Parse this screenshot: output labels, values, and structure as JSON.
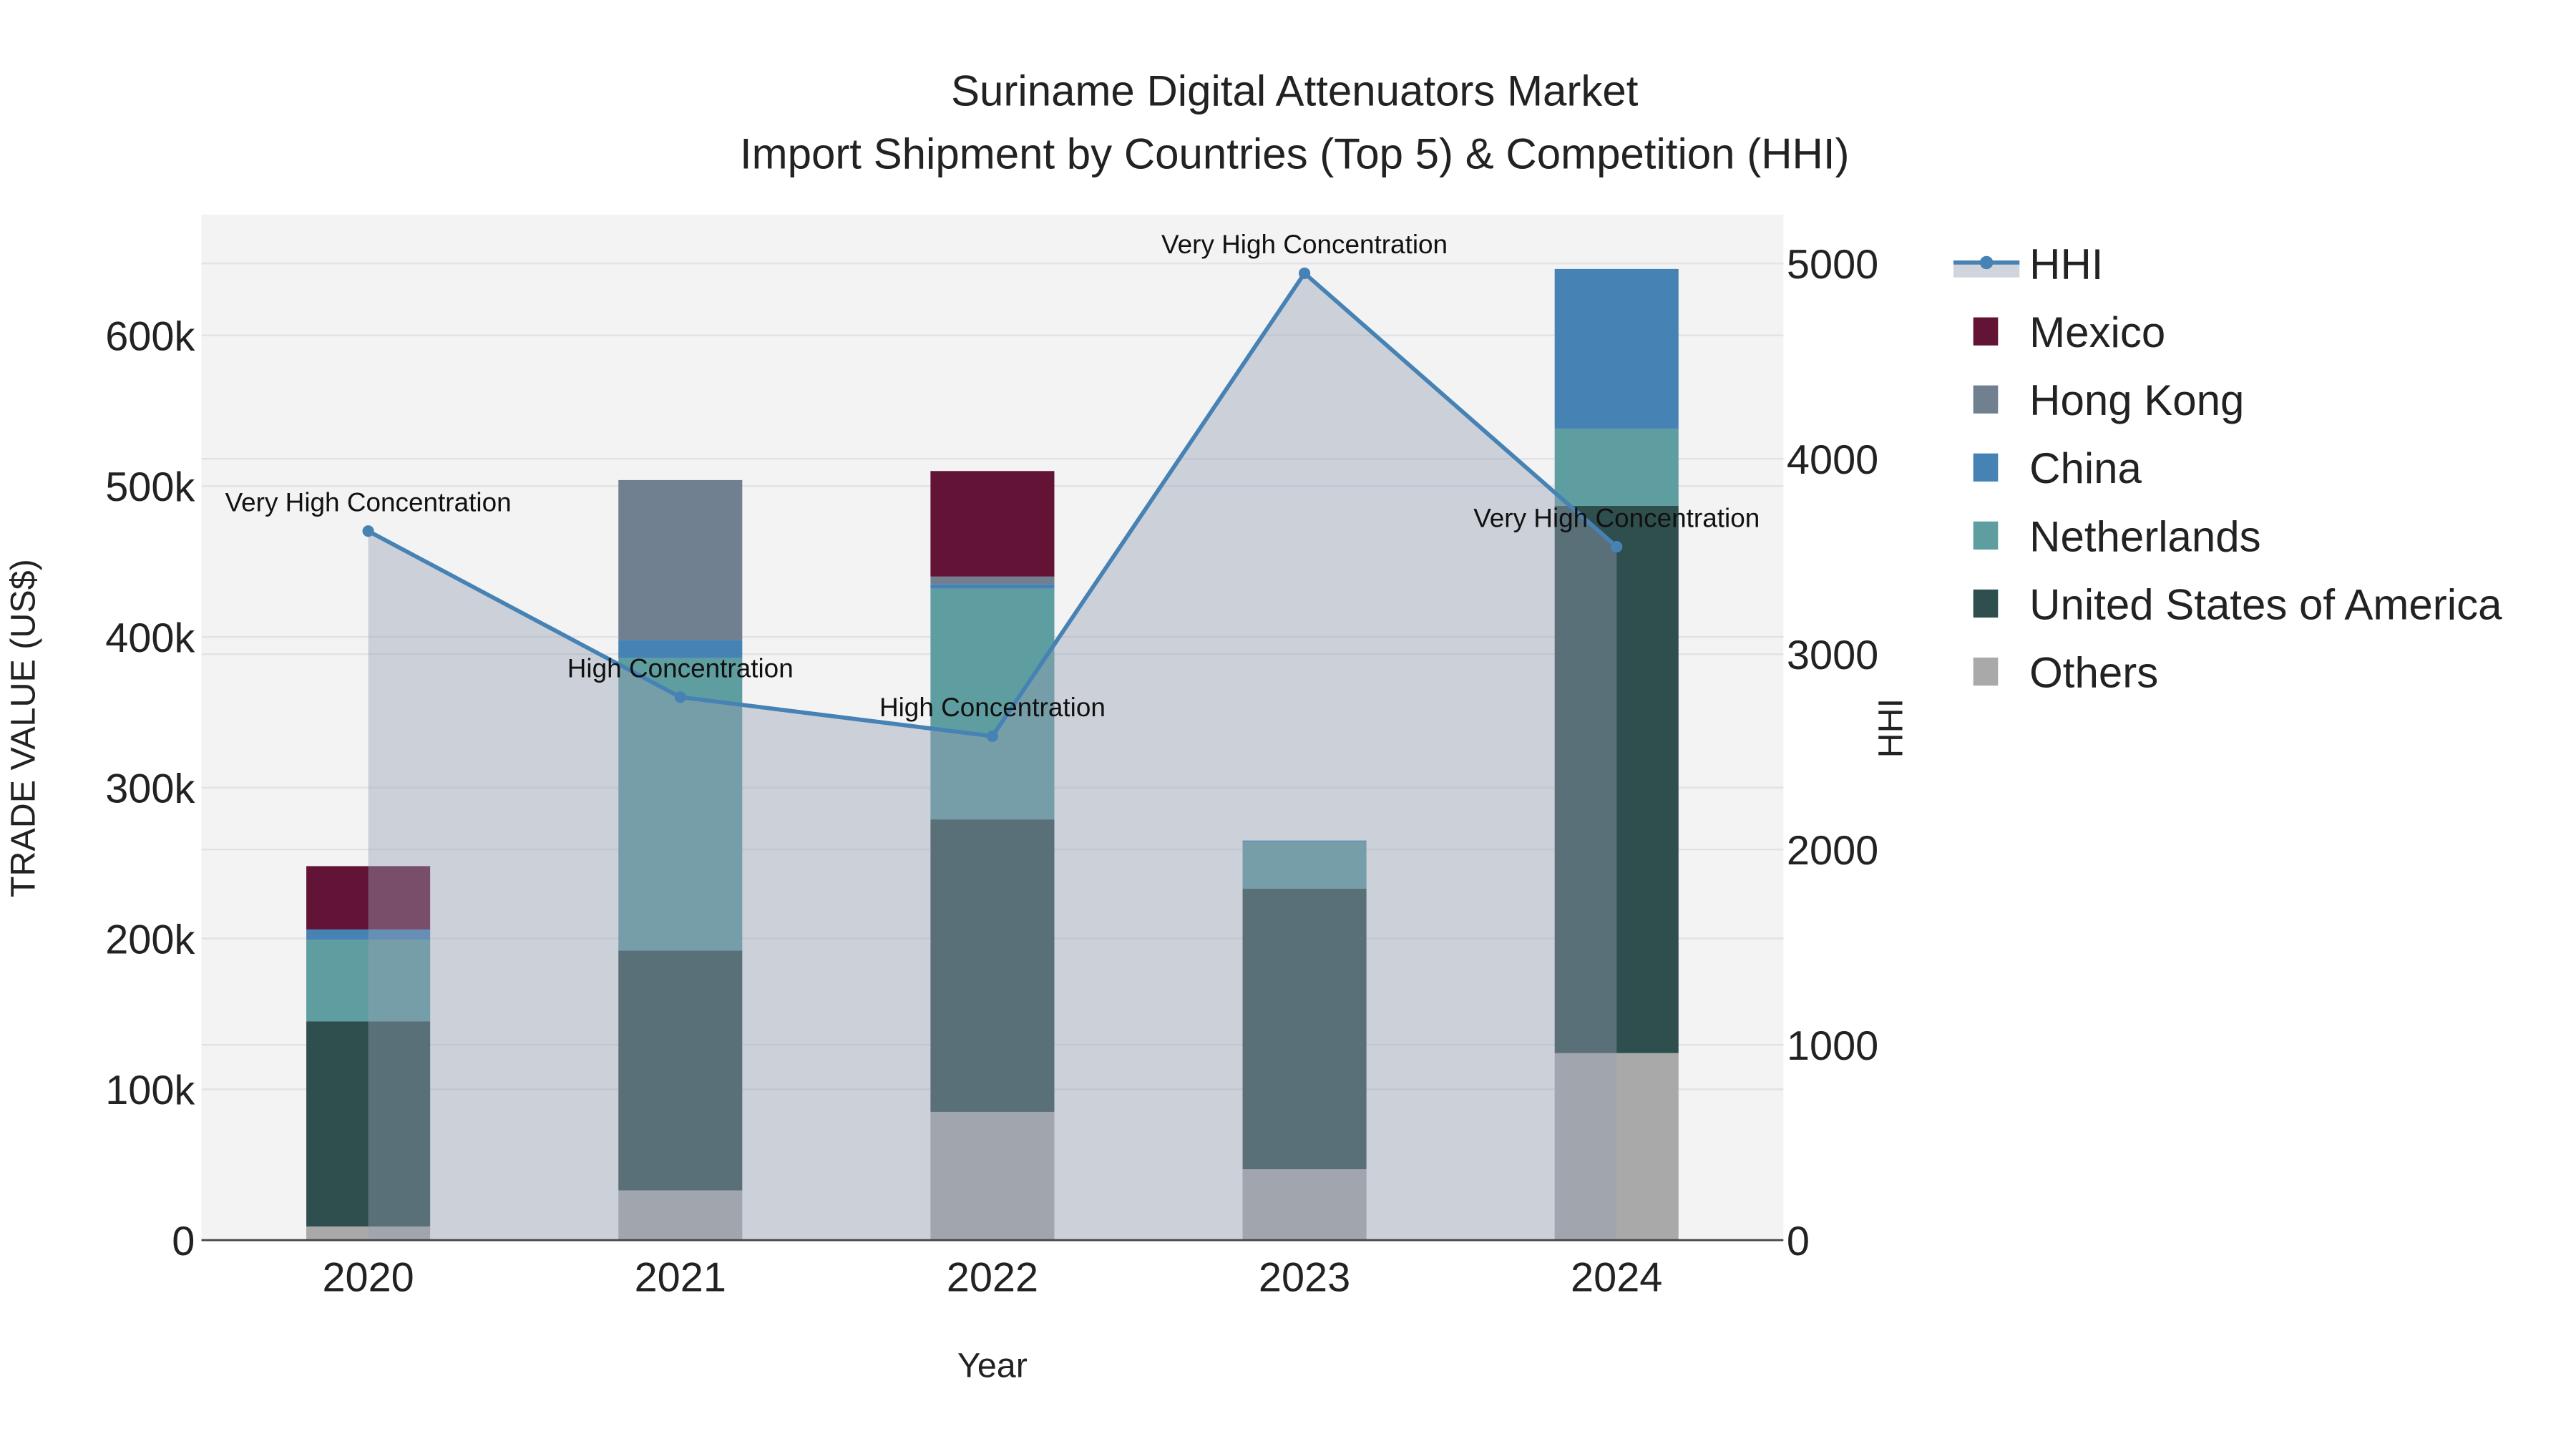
{
  "chart_data": {
    "type": "bar",
    "title_line1": "Suriname Digital Attenuators Market",
    "title_line2": "Import Shipment by Countries (Top 5) & Competition (HHI)",
    "xlabel": "Year",
    "ylabel": "TRADE VALUE (US$)",
    "y2label": "HHI",
    "categories": [
      "2020",
      "2021",
      "2022",
      "2023",
      "2024"
    ],
    "ylim": [
      0,
      680000
    ],
    "y_ticks": [
      0,
      100000,
      200000,
      300000,
      400000,
      500000,
      600000
    ],
    "y_tick_labels": [
      "0",
      "100k",
      "200k",
      "300k",
      "400k",
      "500k",
      "600k"
    ],
    "y2lim": [
      0,
      5250
    ],
    "y2_ticks": [
      0,
      1000,
      2000,
      3000,
      4000,
      5000
    ],
    "y2_tick_labels": [
      "0",
      "1000",
      "2000",
      "3000",
      "4000",
      "5000"
    ],
    "stacked": true,
    "series": [
      {
        "name": "Others",
        "color": "#a9a9a9",
        "values": [
          9000,
          33000,
          85000,
          47000,
          124000
        ]
      },
      {
        "name": "United States of America",
        "color": "#2f4f4f",
        "values": [
          136000,
          159000,
          194000,
          186000,
          363000
        ]
      },
      {
        "name": "Netherlands",
        "color": "#5f9ea0",
        "values": [
          54000,
          194000,
          153000,
          31000,
          51000
        ]
      },
      {
        "name": "China",
        "color": "#4682b4",
        "values": [
          7000,
          12000,
          3000,
          1000,
          106000
        ]
      },
      {
        "name": "Hong Kong",
        "color": "#708090",
        "values": [
          0,
          106000,
          5000,
          0,
          0
        ]
      },
      {
        "name": "Mexico",
        "color": "#621336",
        "values": [
          42000,
          0,
          70000,
          0,
          0
        ]
      }
    ],
    "legend_order": [
      "HHI",
      "Mexico",
      "Hong Kong",
      "China",
      "Netherlands",
      "United States of America",
      "Others"
    ],
    "hhi": {
      "name": "HHI",
      "color": "#4682b4",
      "values": [
        3630,
        2780,
        2580,
        4950,
        3550
      ],
      "annotations": [
        "Very High Concentration",
        "High Concentration",
        "High Concentration",
        "Very High Concentration",
        "Very High Concentration"
      ]
    },
    "legend_position": "right",
    "grid": true
  }
}
